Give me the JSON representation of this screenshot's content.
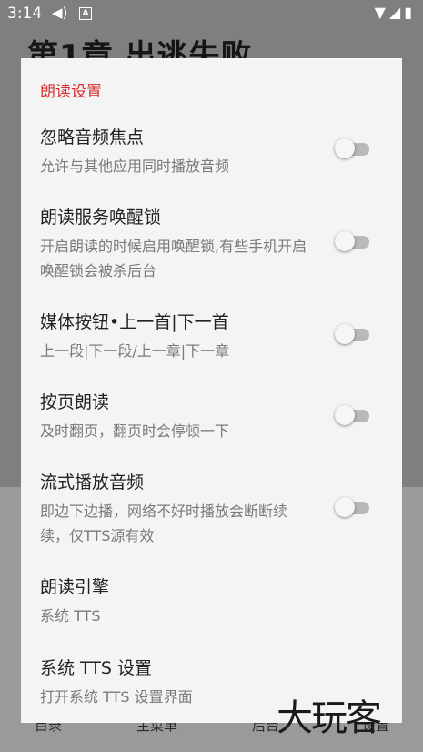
{
  "status_bar": {
    "time": "3:14",
    "notification_letter": "A"
  },
  "background": {
    "chapter_title": "第1章 出逃失败",
    "bottom_nav": [
      "目录",
      "主菜单",
      "后台",
      "设置"
    ]
  },
  "dialog": {
    "title": "朗读设置",
    "title_color": "#d32f2f",
    "items": [
      {
        "title": "忽略音频焦点",
        "summary": "允许与其他应用同时播放音频",
        "has_switch": true,
        "checked": false
      },
      {
        "title": "朗读服务唤醒锁",
        "summary": "开启朗读的时候启用唤醒锁,有些手机开启唤醒锁会被杀后台",
        "has_switch": true,
        "checked": false
      },
      {
        "title": "媒体按钮•上一首|下一首",
        "summary": "上一段|下一段/上一章|下一章",
        "has_switch": true,
        "checked": false
      },
      {
        "title": "按页朗读",
        "summary": "及时翻页，翻页时会停顿一下",
        "has_switch": true,
        "checked": false
      },
      {
        "title": "流式播放音频",
        "summary": "即边下边播，网络不好时播放会断断续续，仅TTS源有效",
        "has_switch": true,
        "checked": false
      },
      {
        "title": "朗读引擎",
        "summary": "系统 TTS",
        "has_switch": false
      },
      {
        "title": "系统 TTS 设置",
        "summary": "打开系统 TTS 设置界面",
        "has_switch": false
      }
    ]
  },
  "watermark": "大玩客"
}
